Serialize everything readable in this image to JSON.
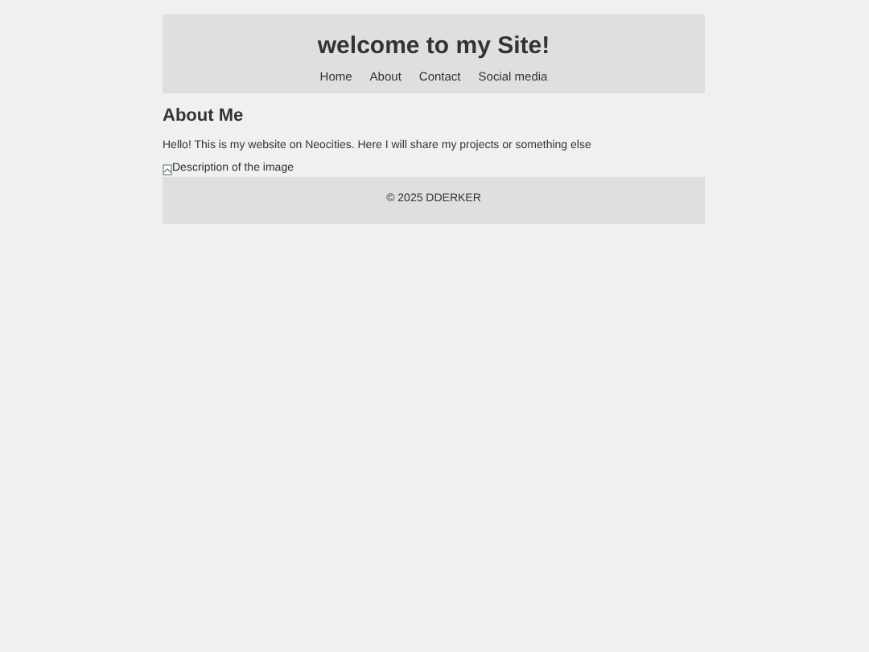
{
  "header": {
    "title": "welcome to my Site!",
    "nav": [
      {
        "label": "Home"
      },
      {
        "label": "About"
      },
      {
        "label": "Contact"
      },
      {
        "label": "Social media"
      }
    ]
  },
  "section": {
    "heading": "About Me",
    "text": "Hello! This is my website on Neocities. Here I will share my projects or something else",
    "image_alt": "Description of the image"
  },
  "footer": {
    "text": "© 2025 DDERKER"
  }
}
